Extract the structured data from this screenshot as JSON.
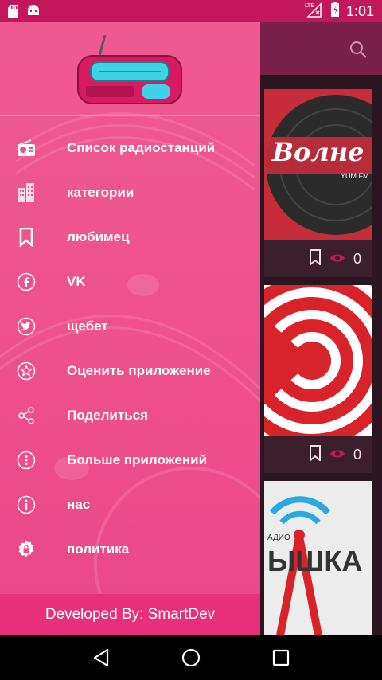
{
  "status_bar": {
    "time": "1:01",
    "icons": [
      "sd-card-icon",
      "android-icon",
      "no-signal-icon",
      "battery-charging-icon"
    ],
    "network_label": "LTE"
  },
  "menu": [
    {
      "label": "Список радиостанций",
      "icon": "radio-icon"
    },
    {
      "label": "категории",
      "icon": "buildings-icon"
    },
    {
      "label": "любимец",
      "icon": "bookmark-icon"
    },
    {
      "label": "VK",
      "icon": "facebook-circle-icon"
    },
    {
      "label": "щебет",
      "icon": "twitter-circle-icon"
    },
    {
      "label": "Оценить приложение",
      "icon": "star-circle-icon"
    },
    {
      "label": "Поделиться",
      "icon": "share-icon"
    },
    {
      "label": "Больше приложений",
      "icon": "more-vertical-circle-icon"
    },
    {
      "label": "нас",
      "icon": "info-circle-icon"
    },
    {
      "label": "политика",
      "icon": "lock-gear-icon"
    }
  ],
  "footer": {
    "label": "Developed By: SmartDev"
  },
  "cards": [
    {
      "count": "0",
      "img_text": "Волне",
      "img_sub": "YUM.FM"
    },
    {
      "count": "0"
    },
    {
      "img_text": "ЫШКА",
      "img_sub": "АДИО"
    }
  ],
  "colors": {
    "drawer": "#ee4f8b",
    "footer": "#e8307a",
    "status_bar": "#c2185b",
    "toolbar": "#7b2048"
  }
}
